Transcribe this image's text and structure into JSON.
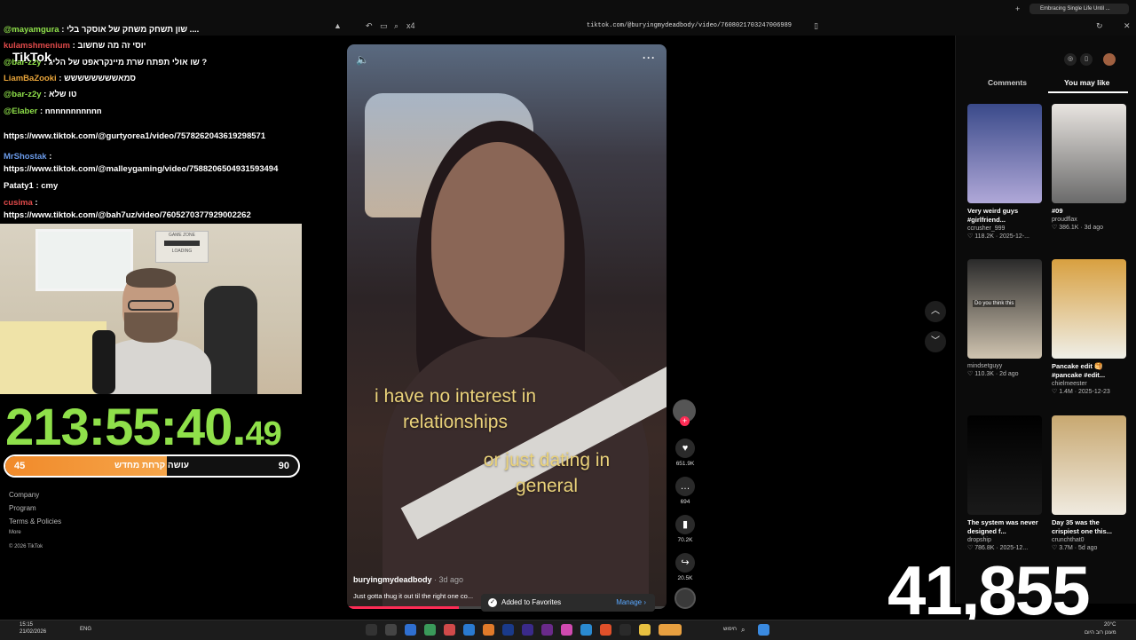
{
  "browser": {
    "url": "tiktok.com/@buryingmydeadbody/video/7608021703247006989",
    "tab_title": "Embracing Single Life Until ... ",
    "address_left_icon": "x4"
  },
  "chat": [
    {
      "user": "@mayamgura",
      "msg": ": שון תשחק משחק של אוסקר בלי ....",
      "color": "green"
    },
    {
      "user": "kulamshmenium",
      "msg": ": יוסי זה מה שחשוב",
      "color": "red"
    },
    {
      "user": "@bar-z2y",
      "msg": ": שו אולי תפתח שרת מיינקראפט של הליג ?",
      "color": "green"
    },
    {
      "user": "LiamBaZooki",
      "msg": ": סמאשששששששש",
      "color": "orange"
    },
    {
      "user": "@bar-z2y",
      "msg": ": טו שלא",
      "color": "green"
    },
    {
      "user": "@Elaber",
      "msg": ": nnnnnnnnnnn",
      "color": "green"
    },
    {
      "user": "",
      "msg": "https://www.tiktok.com/@gurtyorea1/video/7578262043619298571",
      "color": "white"
    },
    {
      "user": "MrShostak",
      "msg": ":",
      "color": "blue"
    },
    {
      "user": "",
      "msg": "https://www.tiktok.com/@malleygaming/video/7588206504931593494",
      "color": "white"
    },
    {
      "user": "Pataty1",
      "msg": ": cmy",
      "color": "white"
    },
    {
      "user": "cusima",
      "msg": ":",
      "color": "red"
    },
    {
      "user": "",
      "msg": "https://www.tiktok.com/@bah7uz/video/7605270377929002262",
      "color": "white"
    }
  ],
  "tiktok_logo": "TikTok",
  "webcam": {
    "poster_line1": "GAME ZONE",
    "poster_line2": "LOADING"
  },
  "timer": {
    "main": "213:55:40.",
    "fraction": "49"
  },
  "progress": {
    "left": "45",
    "right": "90",
    "label": "עושה קרחת מחדש",
    "fraction": 0.55
  },
  "footer_links": [
    "Company",
    "Program",
    "Terms & Policies",
    "More",
    "© 2026 TikTok"
  ],
  "video": {
    "caption1": "i have no interest in relationships",
    "caption2": "or just dating in general",
    "author": "buryingmydeadbody",
    "age": " · 3d ago",
    "description": "Just gotta thug it out til the right one co...",
    "progress": 0.35
  },
  "toast": {
    "text": "Added to Favorites",
    "manage": "Manage"
  },
  "actions": [
    {
      "icon": "heart-icon",
      "glyph": "♥",
      "count": "651.9K"
    },
    {
      "icon": "comment-icon",
      "glyph": "…",
      "count": "694"
    },
    {
      "icon": "bookmark-icon",
      "glyph": "▮",
      "count": "70.2K"
    },
    {
      "icon": "share-icon",
      "glyph": "↪",
      "count": "20.5K"
    }
  ],
  "right_panel": {
    "tabs": [
      "Comments",
      "You may like"
    ],
    "cards": [
      {
        "title": "Very weird guys #girlfriend...",
        "user": "ccrusher_999",
        "stat": "♡ 118.2K · 2025-12-...",
        "colors": [
          "#3a4a8a",
          "#b0a8d8"
        ]
      },
      {
        "title": "#09",
        "user": "proudflax",
        "stat": "♡ 386.1K · 3d ago",
        "colors": [
          "#e8e4e0",
          "#6a6a6a"
        ]
      },
      {
        "title": "",
        "user": "mindsetguyy",
        "stat": "♡ 110.3K · 2d ago",
        "colors": [
          "#2a2a2a",
          "#d0c4b0"
        ]
      },
      {
        "title": "Pancake edit 🥞 #pancake #edit...",
        "user": "chielmeester",
        "stat": "♡ 1.4M · 2025-12-23",
        "colors": [
          "#d8a040",
          "#efefe8"
        ]
      },
      {
        "title": "The system was never designed f...",
        "user": "dropship",
        "stat": "♡ 786.8K · 2025-12...",
        "colors": [
          "#000000",
          "#1a1a1a"
        ]
      },
      {
        "title": "Day 35 was the crispiest one this...",
        "user": "crunchthat0",
        "stat": "♡ 3.7M · 5d ago",
        "colors": [
          "#c8a870",
          "#f0ebe0"
        ]
      }
    ],
    "thumb_overlay": "Do you think this"
  },
  "big_counter": "41,855",
  "taskbar": {
    "time": "15:15",
    "date": "21/02/2026",
    "lang": "ENG",
    "search": "חיפוש",
    "weather": "20°C",
    "weather_text": "מעונן רוב היום"
  }
}
